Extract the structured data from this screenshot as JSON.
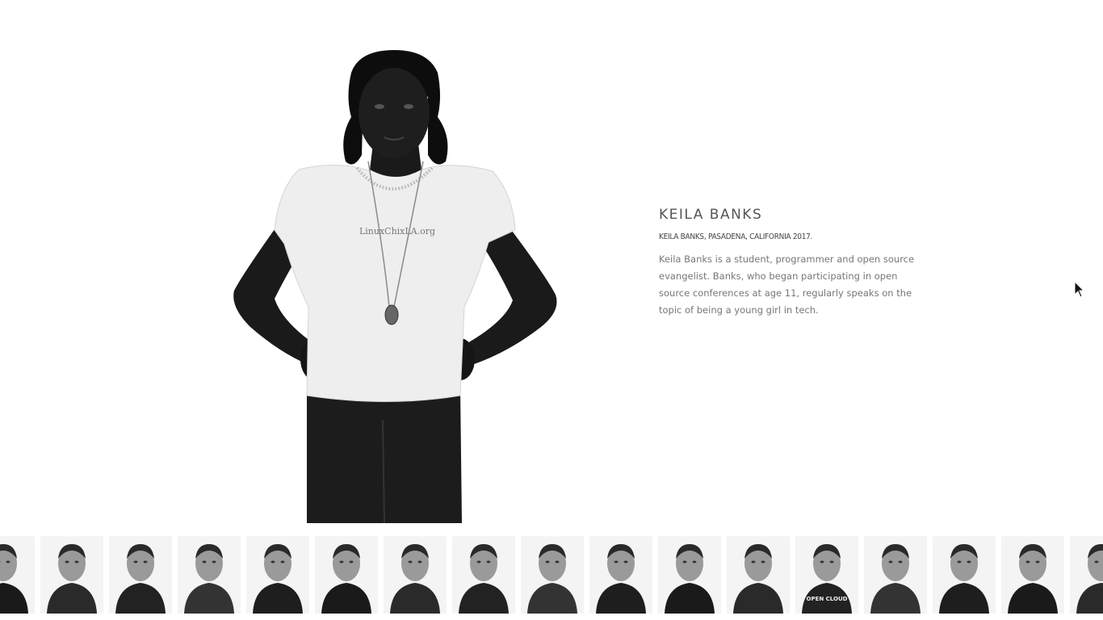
{
  "profile": {
    "name": "KEILA BANKS",
    "caption": "KEILA BANKS, PASADENA, CALIFORNIA 2017.",
    "bio": "Keila Banks is a student, programmer and open source evangelist. Banks, who began participating in open source conferences at age 11, regularly speaks on the topic of being a young girl in tech.",
    "shirt_text": "LinuxChixLA.org"
  },
  "gallery": {
    "thumbnails": [
      {
        "name": "portrait-thumbnail-1"
      },
      {
        "name": "portrait-thumbnail-2"
      },
      {
        "name": "portrait-thumbnail-3"
      },
      {
        "name": "portrait-thumbnail-4"
      },
      {
        "name": "portrait-thumbnail-5"
      },
      {
        "name": "portrait-thumbnail-6"
      },
      {
        "name": "portrait-thumbnail-7"
      },
      {
        "name": "portrait-thumbnail-8"
      },
      {
        "name": "portrait-thumbnail-9"
      },
      {
        "name": "portrait-thumbnail-10"
      },
      {
        "name": "portrait-thumbnail-11"
      },
      {
        "name": "portrait-thumbnail-12"
      },
      {
        "name": "portrait-thumbnail-13",
        "shirt_text": "OPEN CLOUD"
      },
      {
        "name": "portrait-thumbnail-14"
      },
      {
        "name": "portrait-thumbnail-15"
      },
      {
        "name": "portrait-thumbnail-16"
      },
      {
        "name": "portrait-thumbnail-17"
      }
    ]
  },
  "colors": {
    "background": "#ffffff",
    "name_text": "#555555",
    "caption_text": "#444444",
    "bio_text": "#777777"
  }
}
